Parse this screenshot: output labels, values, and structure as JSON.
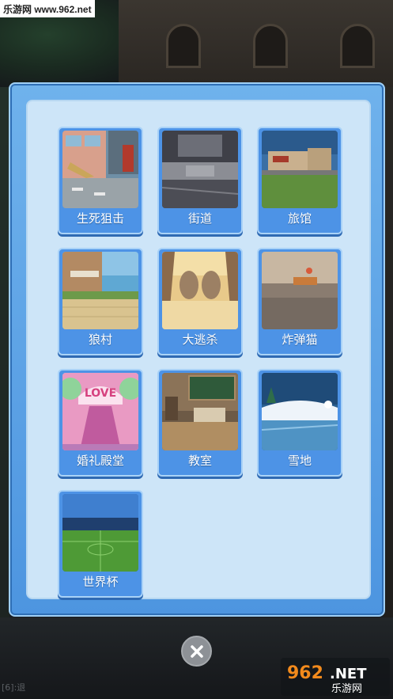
{
  "watermark_top": "乐游网 www.962.net",
  "watermark_logo": "962.NET 乐游网",
  "background_hint": "[6]:退",
  "scenes": [
    {
      "label": "生死狙击",
      "icon": "street-shop-scene"
    },
    {
      "label": "街道",
      "icon": "city-street-scene"
    },
    {
      "label": "旅馆",
      "icon": "motel-scene"
    },
    {
      "label": "狼村",
      "icon": "village-scene"
    },
    {
      "label": "大逃杀",
      "icon": "arena-scene"
    },
    {
      "label": "炸弹猫",
      "icon": "rooftop-scene"
    },
    {
      "label": "婚礼殿堂",
      "icon": "wedding-scene"
    },
    {
      "label": "教室",
      "icon": "classroom-scene"
    },
    {
      "label": "雪地",
      "icon": "snow-scene"
    },
    {
      "label": "世界杯",
      "icon": "stadium-scene"
    }
  ],
  "close_icon": "close-icon"
}
